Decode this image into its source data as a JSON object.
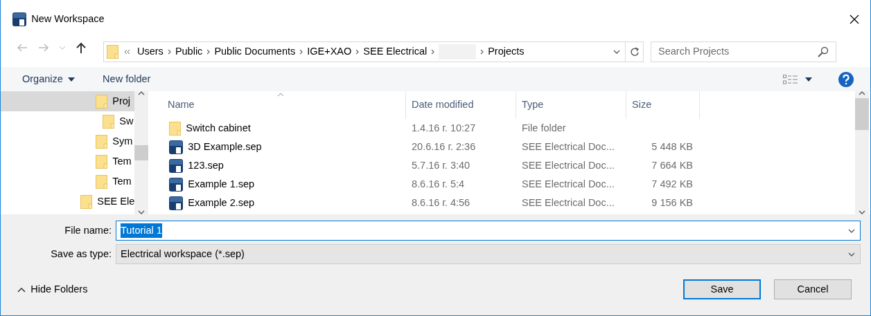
{
  "window": {
    "title": "New Workspace"
  },
  "address": {
    "crumbs": [
      {
        "kind": "text",
        "label": "Users"
      },
      {
        "kind": "text",
        "label": "Public"
      },
      {
        "kind": "text",
        "label": "Public Documents"
      },
      {
        "kind": "text",
        "label": "IGE+XAO"
      },
      {
        "kind": "text",
        "label": "SEE Electrical"
      },
      {
        "kind": "redacted"
      },
      {
        "kind": "text",
        "label": "Projects"
      }
    ]
  },
  "search": {
    "placeholder": "Search Projects"
  },
  "toolbar": {
    "organize": "Organize",
    "new_folder": "New folder"
  },
  "nav_tree": {
    "items": [
      {
        "label": "Proj",
        "selected": true,
        "children": [
          {
            "label": "Sw",
            "selected": false
          }
        ]
      },
      {
        "label": "Sym",
        "selected": false
      },
      {
        "label": "Tem",
        "selected": false
      },
      {
        "label": "Tem",
        "selected": false
      }
    ],
    "outer_items": [
      {
        "label": "SEE Ele",
        "selected": false
      }
    ]
  },
  "table": {
    "columns": [
      "Name",
      "Date modified",
      "Type",
      "Size"
    ],
    "rows": [
      {
        "kind": "folder",
        "name": "Switch cabinet",
        "date": "1.4.16 г. 10:27",
        "type": "File folder"
      },
      {
        "kind": "file",
        "name": "3D Example.sep",
        "date": "20.6.16 г. 2:36",
        "type": "SEE Electrical Doc...",
        "size": "5 448 KB"
      },
      {
        "kind": "file",
        "name": "123.sep",
        "date": "5.7.16 г. 3:40",
        "type": "SEE Electrical Doc...",
        "size": "7 664 KB"
      },
      {
        "kind": "file",
        "name": "Example 1.sep",
        "date": "8.6.16 г. 5:4",
        "type": "SEE Electrical Doc...",
        "size": "7 492 KB"
      },
      {
        "kind": "file",
        "name": "Example 2.sep",
        "date": "8.6.16 г. 4:56",
        "type": "SEE Electrical Doc...",
        "size": "9 156 KB"
      }
    ]
  },
  "form": {
    "file_name_label": "File name:",
    "file_name": "Tutorial 1",
    "type_label": "Save as type:",
    "type_value": "Electrical workspace (*.sep)"
  },
  "hide_folders": "Hide Folders",
  "buttons": [
    {
      "label": "Save",
      "default": true
    },
    {
      "label": "Cancel",
      "default": false
    }
  ]
}
